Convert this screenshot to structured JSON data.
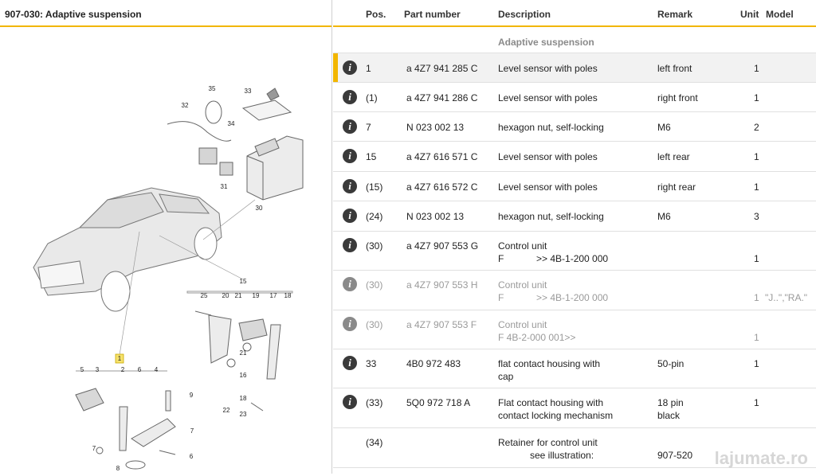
{
  "left_panel": {
    "title": "907-030: Adaptive suspension",
    "callouts": [
      "35",
      "33",
      "32",
      "34",
      "31",
      "30",
      "15",
      "25",
      "20",
      "21",
      "19",
      "17",
      "18",
      "21",
      "16",
      "22",
      "18",
      "23",
      "1",
      "5",
      "3",
      "2",
      "6",
      "4",
      "9",
      "7",
      "7",
      "6",
      "8"
    ]
  },
  "table": {
    "headers": {
      "pos": "Pos.",
      "part": "Part number",
      "desc": "Description",
      "remark": "Remark",
      "unit": "Unit",
      "model": "Model"
    },
    "section_title": "Adaptive suspension",
    "rows": [
      {
        "pos": "1",
        "part": "a 4Z7 941 285 C",
        "desc": "Level sensor with poles",
        "remark": "left front",
        "unit": "1",
        "model": ""
      },
      {
        "pos": "(1)",
        "part": "a 4Z7 941 286 C",
        "desc": "Level sensor with poles",
        "remark": "right front",
        "unit": "1",
        "model": ""
      },
      {
        "pos": "7",
        "part": "N   023 002 13",
        "desc": "hexagon nut, self-locking",
        "remark": "M6",
        "unit": "2",
        "model": ""
      },
      {
        "pos": "15",
        "part": "a 4Z7 616 571 C",
        "desc": "Level sensor with poles",
        "remark": "left rear",
        "unit": "1",
        "model": ""
      },
      {
        "pos": "(15)",
        "part": "a 4Z7 616 572 C",
        "desc": "Level sensor with poles",
        "remark": "right rear",
        "unit": "1",
        "model": ""
      },
      {
        "pos": "(24)",
        "part": "N   023 002 13",
        "desc": "hexagon nut, self-locking",
        "remark": "M6",
        "unit": "3",
        "model": ""
      },
      {
        "pos": "(30)",
        "part": "a 4Z7 907 553 G",
        "desc": "Control unit",
        "desc2a": "F",
        "desc2b": ">> 4B-1-200 000",
        "remark": "",
        "unit": "1",
        "model": ""
      },
      {
        "pos": "(30)",
        "part": "a 4Z7 907 553 H",
        "desc": "Control unit",
        "desc2a": "F",
        "desc2b": ">> 4B-1-200 000",
        "remark": "",
        "unit": "1",
        "model": "\"J..\",\"RA.\""
      },
      {
        "pos": "(30)",
        "part": "a 4Z7 907 553 F",
        "desc": "Control unit",
        "desc2a": "F 4B-2-000 001>>",
        "desc2b": "",
        "remark": "",
        "unit": "1",
        "model": ""
      },
      {
        "pos": "33",
        "part": "4B0 972 483",
        "desc": "flat contact housing with",
        "desc2a": "cap",
        "remark": "50-pin",
        "unit": "1",
        "model": ""
      },
      {
        "pos": "(33)",
        "part": "5Q0 972 718 A",
        "desc": "Flat contact housing with",
        "desc2a": "contact locking mechanism",
        "remark": "18 pin",
        "remark2": "black",
        "unit": "1",
        "model": ""
      },
      {
        "pos": "(34)",
        "part": "",
        "desc": "Retainer for control unit",
        "desc2a": "see illustration:",
        "remark": "",
        "remark2": "907-520",
        "unit": "",
        "model": ""
      }
    ]
  },
  "info_icon": "info-icon",
  "watermark": "lajumate.ro"
}
